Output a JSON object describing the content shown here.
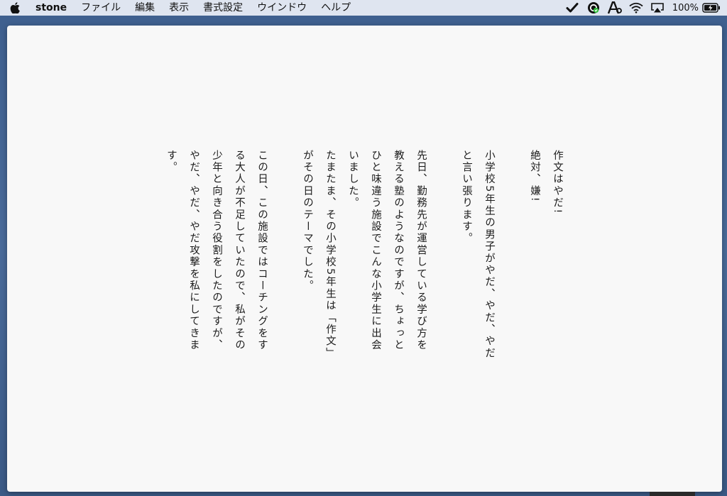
{
  "menubar": {
    "apple_icon": "apple-icon",
    "app_name": "stone",
    "menus": [
      "ファイル",
      "編集",
      "表示",
      "書式設定",
      "ウインドウ",
      "ヘルプ"
    ],
    "status_icons": [
      "checkmark-icon",
      "sync-icon",
      "font-icon",
      "wifi-icon",
      "airplay-icon"
    ],
    "battery_percent": "100%",
    "battery_icon": "battery-charging-icon"
  },
  "document": {
    "writing_mode": "vertical",
    "paragraphs": [
      "作文はやだ!",
      "絶対、嫌!",
      "",
      "小学校5年生の男子がやだ、やだ、やだと言い張ります。",
      "",
      "先日、勤務先が運営している学び方を教える塾のようなのですが、ちょっとひと味違う施設でこんな小学生に出会いました。",
      "たまたま、その小学校5年生は「作文」がその日のテーマでした。",
      "",
      "この日、この施設ではコーチングをする大人が不足していたので、私がその少年と向き合う役割をしたのですが、やだ、やだ、やだ攻撃を私にしてきます。"
    ]
  }
}
